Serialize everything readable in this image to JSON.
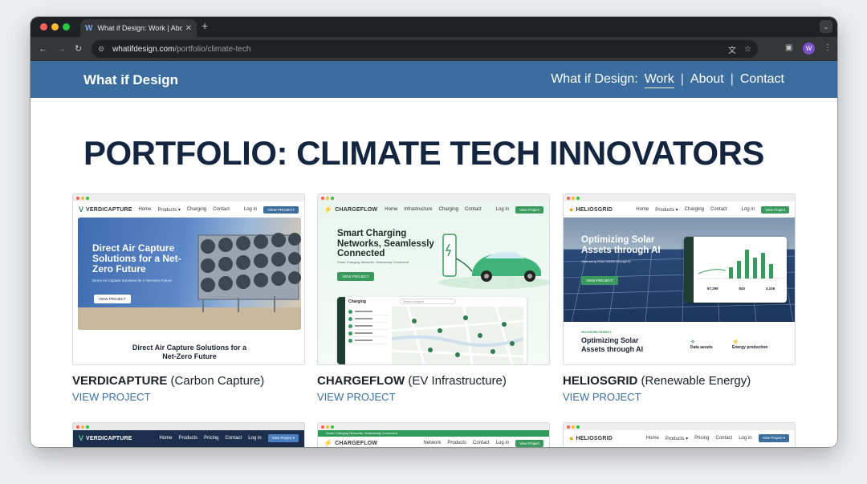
{
  "browser": {
    "tab_title": "What if Design: Work | About",
    "tab_favicon": "W",
    "url_domain": "whatifdesign.com",
    "url_path": "/portfolio/climate-tech",
    "profile_initial": "W"
  },
  "site": {
    "brand": "What if Design",
    "nav": {
      "prefix": "What if Design:",
      "work": "Work",
      "about": "About",
      "contact": "Contact",
      "separator": "|"
    },
    "accent_color": "#3b6e9e"
  },
  "page": {
    "title": "PORTFOLIO: CLIMATE TECH INNOVATORS"
  },
  "cards": [
    {
      "name": "VERDICAPTURE",
      "category": "(Carbon Capture)",
      "view": "VIEW PROJECT",
      "preview": {
        "logo": "VERDICAPTURE",
        "nav": [
          "Home",
          "Products ▾",
          "Charging",
          "Contact"
        ],
        "login": "Log in",
        "cta": "VIEW PROJECT",
        "hero_heading": "Direct Air Capture Solutions for a Net-Zero Future",
        "hero_text": "Direct Air Capture Solutions for a Net-Zero Future",
        "hero_button": "VIEW PROJECT",
        "caption": "Direct Air Capture Solutions for a Net-Zero Future"
      }
    },
    {
      "name": "CHARGEFLOW",
      "category": "(EV Infrastructure)",
      "view": "VIEW PROJECT",
      "preview": {
        "logo": "CHARGEFLOW",
        "nav": [
          "Home",
          "Infrastructure",
          "Charging",
          "Contact"
        ],
        "login": "Log in",
        "cta": "View Project",
        "hero_heading": "Smart Charging Networks, Seamlessly Connected",
        "hero_text": "Smart Charging Networks, Seamlessly Connected",
        "hero_button": "VIEW PROJECT",
        "app_title": "Charging",
        "app_search": "Search chargers"
      }
    },
    {
      "name": "HELIOSGRID",
      "category": "(Renewable Energy)",
      "view": "VIEW PROJECT",
      "preview": {
        "logo": "HELIOSGRID",
        "nav": [
          "Home",
          "Products ▾",
          "Charging",
          "Contact"
        ],
        "login": "Log in",
        "cta": "View Project",
        "hero_heading": "Optimizing Solar Assets through AI",
        "hero_text": "Optimizing Solar Assets through AI",
        "hero_button": "VIEW PROJECT",
        "stats": [
          "67,299",
          "840",
          "3,108"
        ],
        "lower_kicker": "HELIOSGRID ENERGY",
        "lower_heading": "Optimizing Solar Assets through AI",
        "features": [
          "Data assets",
          "Energy production"
        ]
      }
    }
  ],
  "row2": [
    {
      "logo": "VERDICAPTURE",
      "nav": [
        "Home",
        "Products",
        "Pricing",
        "Contact"
      ],
      "login": "Log in",
      "cta": "View Project ▾"
    },
    {
      "banner": "Smart Charging Networks, Seamlessly Connected",
      "logo": "CHARGEFLOW",
      "nav": [
        "Network",
        "Products",
        "Contact"
      ],
      "login": "Log in",
      "cta": "View Project"
    },
    {
      "logo": "HELIOSGRID",
      "nav": [
        "Home",
        "Products ▾",
        "Pricing",
        "Contact"
      ],
      "login": "Log in",
      "cta": "View Project ▾"
    }
  ]
}
